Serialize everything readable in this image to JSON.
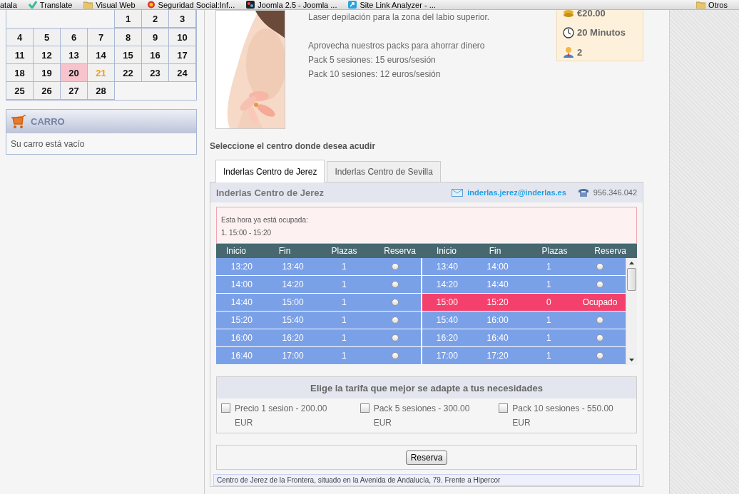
{
  "bookmarks": [
    {
      "label": "atala",
      "kind": "none"
    },
    {
      "label": "Translate",
      "kind": "check"
    },
    {
      "label": "Visual Web",
      "kind": "folder"
    },
    {
      "label": "Seguridad Social:Inf...",
      "kind": "seal"
    },
    {
      "label": "Joomla 2.5 - Joomla ...",
      "kind": "joomla"
    },
    {
      "label": "Site Link Analyzer - ...",
      "kind": "arrow"
    }
  ],
  "other_bookmarks": {
    "label": "Otros"
  },
  "calendar": {
    "weeks": [
      [
        {
          "day": "1",
          "highlighted": false,
          "today": false
        },
        {
          "day": "2",
          "highlighted": false,
          "today": false
        },
        {
          "day": "3",
          "highlighted": false,
          "today": false
        }
      ],
      [
        {
          "day": "4",
          "highlighted": false,
          "today": false
        },
        {
          "day": "5",
          "highlighted": false,
          "today": false
        },
        {
          "day": "6",
          "highlighted": false,
          "today": false
        },
        {
          "day": "7",
          "highlighted": false,
          "today": false
        },
        {
          "day": "8",
          "highlighted": false,
          "today": false
        },
        {
          "day": "9",
          "highlighted": false,
          "today": false
        },
        {
          "day": "10",
          "highlighted": false,
          "today": false
        }
      ],
      [
        {
          "day": "11",
          "highlighted": false,
          "today": false
        },
        {
          "day": "12",
          "highlighted": false,
          "today": false
        },
        {
          "day": "13",
          "highlighted": false,
          "today": false
        },
        {
          "day": "14",
          "highlighted": false,
          "today": false
        },
        {
          "day": "15",
          "highlighted": false,
          "today": false
        },
        {
          "day": "16",
          "highlighted": false,
          "today": false
        },
        {
          "day": "17",
          "highlighted": false,
          "today": false
        }
      ],
      [
        {
          "day": "18",
          "highlighted": false,
          "today": false
        },
        {
          "day": "19",
          "highlighted": false,
          "today": false
        },
        {
          "day": "20",
          "highlighted": true,
          "today": false
        },
        {
          "day": "21",
          "highlighted": false,
          "today": true
        },
        {
          "day": "22",
          "highlighted": false,
          "today": false
        },
        {
          "day": "23",
          "highlighted": false,
          "today": false
        },
        {
          "day": "24",
          "highlighted": false,
          "today": false
        }
      ],
      [
        {
          "day": "25",
          "highlighted": false,
          "today": false
        },
        {
          "day": "26",
          "highlighted": false,
          "today": false
        },
        {
          "day": "27",
          "highlighted": false,
          "today": false
        },
        {
          "day": "28",
          "highlighted": false,
          "today": false
        }
      ]
    ]
  },
  "cart": {
    "title": "CARRO",
    "message": "Su carro está vacío"
  },
  "treatment": {
    "intro": "Laser depilación para la zona del labio superior.",
    "description": [
      "Aprovecha nuestros packs para ahorrar dinero",
      "Pack 5 sesiones: 15 euros/sesión",
      "Pack 10 sesiones: 12 euros/sesión"
    ],
    "info": [
      {
        "kind": "price",
        "text": "€20.00"
      },
      {
        "kind": "duration",
        "text": "20 Minutos"
      },
      {
        "kind": "people",
        "text": "2"
      }
    ]
  },
  "center_prompt": "Seleccione el centro donde desea acudir",
  "tabs": [
    {
      "label": "Inderlas Centro de Jerez",
      "selected": true
    },
    {
      "label": "Inderlas Centro de Sevilla",
      "selected": false
    }
  ],
  "center": {
    "name": "Inderlas Centro de Jerez",
    "email": "inderlas.jerez@inderlas.es",
    "phone": "956.346.042"
  },
  "alert": {
    "title": "Esta hora ya está ocupada:",
    "items": [
      "1. 15:00 - 15:20"
    ]
  },
  "slots": {
    "columns": [
      "Inicio",
      "Fin",
      "Plazas",
      "Reserva",
      "Inicio",
      "Fin",
      "Plazas",
      "Reserva"
    ],
    "rows": [
      {
        "left": {
          "start": "13:20",
          "end": "13:40",
          "places": "1",
          "booked": false,
          "selected": false
        },
        "right": {
          "start": "13:40",
          "end": "14:00",
          "places": "1",
          "booked": false,
          "selected": false
        }
      },
      {
        "left": {
          "start": "14:00",
          "end": "14:20",
          "places": "1",
          "booked": false,
          "selected": false
        },
        "right": {
          "start": "14:20",
          "end": "14:40",
          "places": "1",
          "booked": false,
          "selected": false
        }
      },
      {
        "left": {
          "start": "14:40",
          "end": "15:00",
          "places": "1",
          "booked": false,
          "selected": false
        },
        "right": {
          "start": "15:00",
          "end": "15:20",
          "places": "0",
          "booked": true,
          "status": "Ocupado"
        }
      },
      {
        "left": {
          "start": "15:20",
          "end": "15:40",
          "places": "1",
          "booked": false,
          "selected": false
        },
        "right": {
          "start": "15:40",
          "end": "16:00",
          "places": "1",
          "booked": false,
          "selected": false
        }
      },
      {
        "left": {
          "start": "16:00",
          "end": "16:20",
          "places": "1",
          "booked": false,
          "selected": false
        },
        "right": {
          "start": "16:20",
          "end": "16:40",
          "places": "1",
          "booked": false,
          "selected": false
        }
      },
      {
        "left": {
          "start": "16:40",
          "end": "17:00",
          "places": "1",
          "booked": false,
          "selected": false
        },
        "right": {
          "start": "17:00",
          "end": "17:20",
          "places": "1",
          "booked": false,
          "selected": false
        }
      }
    ]
  },
  "rates": {
    "title": "Elige la tarifa que mejor se adapte a tus necesidades",
    "options": [
      {
        "label": "Precio 1 sesion - 200.00 EUR",
        "checked": false
      },
      {
        "label": "Pack 5 sesiones - 300.00 EUR",
        "checked": false
      },
      {
        "label": "Pack 10 sesiones - 550.00 EUR",
        "checked": false
      }
    ]
  },
  "reserve_button": "Reserva",
  "footer_text": "Centro de Jerez de la Frontera, situado en la Avenida de Andalucía, 79. Frente a Hipercor"
}
